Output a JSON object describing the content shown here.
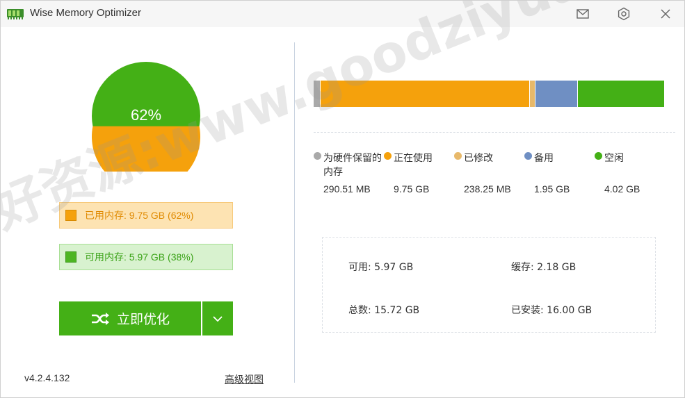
{
  "window": {
    "title": "Wise Memory Optimizer"
  },
  "colors": {
    "orange": "#f5a10c",
    "green": "#44b016",
    "gray": "#a9a9a9",
    "modified": "#e8b96a",
    "standby": "#6f8fc3"
  },
  "pie": {
    "used_fraction": 0.62,
    "label": "62%"
  },
  "legend": {
    "used": "已用内存: 9.75 GB (62%)",
    "free": "可用内存: 5.97 GB (38%)"
  },
  "actions": {
    "optimize": "立即优化"
  },
  "footer": {
    "version": "v4.2.4.132",
    "advanced": "高级视图"
  },
  "memory_bar": [
    {
      "name": "hardware",
      "gb": 0.2837
    },
    {
      "name": "in-use",
      "gb": 9.75
    },
    {
      "name": "modified",
      "gb": 0.2327
    },
    {
      "name": "standby",
      "gb": 1.95
    },
    {
      "name": "free",
      "gb": 4.02
    }
  ],
  "categories": [
    {
      "name": "为硬件保留的内存",
      "value": "290.51 MB"
    },
    {
      "name": "正在使用",
      "value": "9.75 GB"
    },
    {
      "name": "已修改",
      "value": "238.25 MB"
    },
    {
      "name": "备用",
      "value": "1.95 GB"
    },
    {
      "name": "空闲",
      "value": "4.02 GB"
    }
  ],
  "stats": {
    "available": "可用: 5.97 GB",
    "cached": "缓存: 2.18 GB",
    "total": "总数: 15.72 GB",
    "installed": "已安装: 16.00 GB"
  },
  "watermark": "好资源:www.goodziyuan.com"
}
